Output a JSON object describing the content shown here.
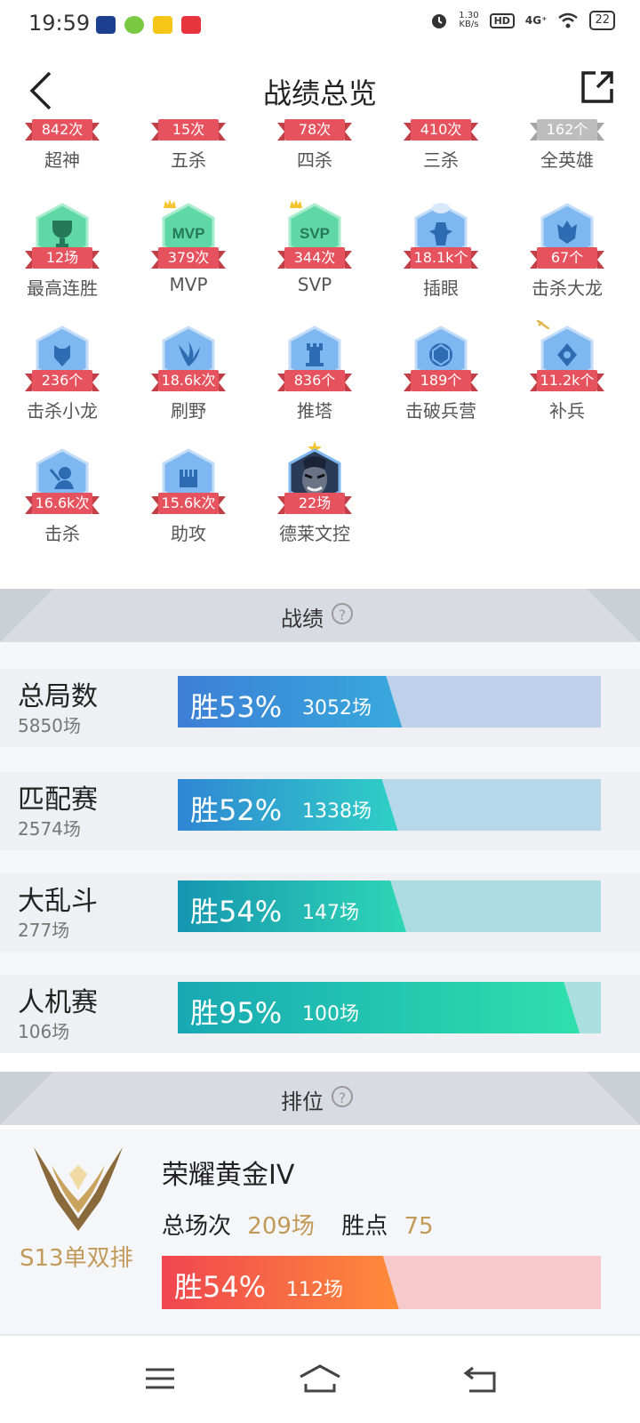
{
  "status_bar": {
    "time": "19:59",
    "speed_value": "1.30",
    "speed_unit": "KB/s",
    "hd": "HD",
    "network": "4G⁺",
    "battery": "22"
  },
  "header": {
    "title": "战绩总览"
  },
  "badges": [
    {
      "value": "842次",
      "label": "超神"
    },
    {
      "value": "15次",
      "label": "五杀"
    },
    {
      "value": "78次",
      "label": "四杀"
    },
    {
      "value": "410次",
      "label": "三杀"
    },
    {
      "value": "162个",
      "label": "全英雄"
    },
    {
      "value": "12场",
      "label": "最高连胜",
      "icon_text": ""
    },
    {
      "value": "379次",
      "label": "MVP",
      "icon_text": "MVP"
    },
    {
      "value": "344次",
      "label": "SVP",
      "icon_text": "SVP"
    },
    {
      "value": "18.1k个",
      "label": "插眼"
    },
    {
      "value": "67个",
      "label": "击杀大龙"
    },
    {
      "value": "236个",
      "label": "击杀小龙"
    },
    {
      "value": "18.6k次",
      "label": "刷野"
    },
    {
      "value": "836个",
      "label": "推塔"
    },
    {
      "value": "189个",
      "label": "击破兵营"
    },
    {
      "value": "11.2k个",
      "label": "补兵"
    },
    {
      "value": "16.6k次",
      "label": "击杀"
    },
    {
      "value": "15.6k次",
      "label": "助攻"
    },
    {
      "value": "22场",
      "label": "德莱文控"
    }
  ],
  "record_section": {
    "title": "战绩",
    "help": "?"
  },
  "records": [
    {
      "name": "总局数",
      "total": "5850场",
      "win_label": "胜53%",
      "win_games": "3052场",
      "win_rate": 0.53,
      "color_a": "#3d7fd6",
      "color_b": "#37a9dc",
      "track": "#bfd0ea"
    },
    {
      "name": "匹配赛",
      "total": "2574场",
      "win_label": "胜52%",
      "win_games": "1338场",
      "win_rate": 0.52,
      "color_a": "#2f86d4",
      "color_b": "#2fd0c6",
      "track": "#b7d7ea"
    },
    {
      "name": "大乱斗",
      "total": "277场",
      "win_label": "胜54%",
      "win_games": "147场",
      "win_rate": 0.54,
      "color_a": "#1596b0",
      "color_b": "#2fd6b6",
      "track": "#acdbe2"
    },
    {
      "name": "人机赛",
      "total": "106场",
      "win_label": "胜95%",
      "win_games": "100场",
      "win_rate": 0.95,
      "color_a": "#18a9b4",
      "color_b": "#2fe0ac",
      "track": "#a9dfe0"
    }
  ],
  "rank_section": {
    "title": "排位",
    "help": "?"
  },
  "rank": {
    "tier": "荣耀黄金IV",
    "season": "S13单双排",
    "total_label": "总场次",
    "total_value": "209场",
    "points_label": "胜点",
    "points_value": "75",
    "win_label": "胜54%",
    "win_games": "112场",
    "win_rate": 0.54
  }
}
